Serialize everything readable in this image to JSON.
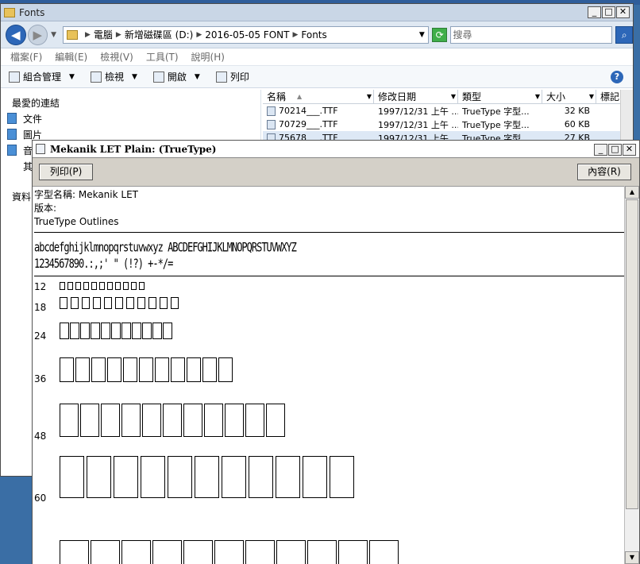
{
  "explorer": {
    "title": "Fonts",
    "breadcrumb": [
      "電腦",
      "新增磁碟區 (D:)",
      "2016-05-05 FONT",
      "Fonts"
    ],
    "search_placeholder": "搜尋",
    "menu": [
      "檔案(F)",
      "編輯(E)",
      "檢視(V)",
      "工具(T)",
      "說明(H)"
    ],
    "toolbar": {
      "organize": "組合管理",
      "view": "檢視",
      "open": "開啟",
      "print": "列印"
    },
    "nav": {
      "favorites": "最愛的連結",
      "items": [
        "文件",
        "圖片",
        "音",
        "其"
      ],
      "data": "資料"
    },
    "columns": [
      "名稱",
      "修改日期",
      "類型",
      "大小",
      "標記"
    ],
    "files": [
      {
        "name": "70214___.TTF",
        "date": "1997/12/31 上午 ...",
        "type": "TrueType 字型...",
        "size": "32 KB"
      },
      {
        "name": "70729___.TTF",
        "date": "1997/12/31 上午 ...",
        "type": "TrueType 字型...",
        "size": "60 KB"
      },
      {
        "name": "75678___.TTF",
        "date": "1997/12/31 上午 ...",
        "type": "TrueType 字型...",
        "size": "27 KB"
      }
    ]
  },
  "viewer": {
    "title": "Mekanik LET Plain: (TrueType)",
    "print_btn": "列印(P)",
    "props_btn": "內容(R)",
    "meta": [
      "字型名稱: Mekanik LET",
      "版本:",
      "TrueType Outlines"
    ],
    "sample_line1": "abcdefghijklmnopqrstuvwxyz ABCDEFGHIJKLMNOPQRSTUVWXYZ",
    "sample_line2": "1234567890.:,;' \" (!?) +-*/=",
    "sizes": [
      "12",
      "18",
      "24",
      "36",
      "48",
      "60"
    ]
  }
}
